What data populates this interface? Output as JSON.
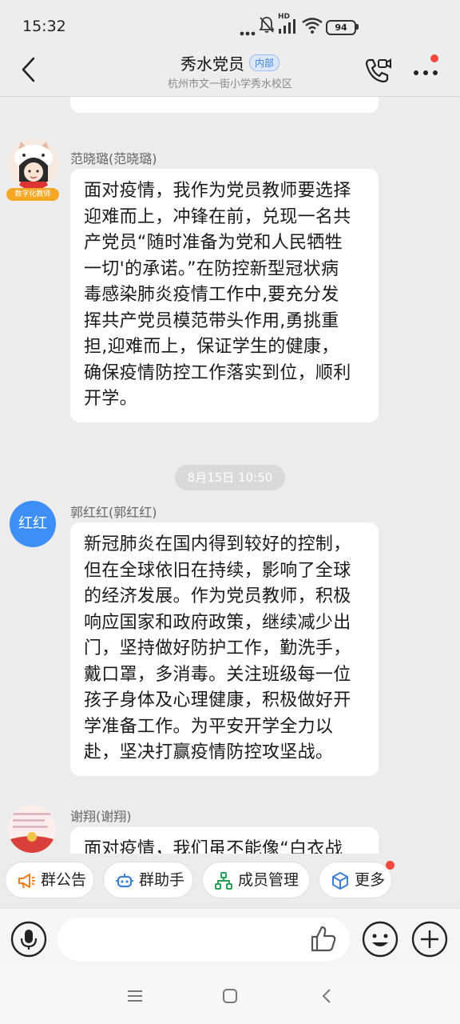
{
  "status": {
    "time": "15:32",
    "network": "HD",
    "battery": "94"
  },
  "header": {
    "title": "秀水党员",
    "badge": "内部",
    "subtitle": "杭州市文一街小学秀水校区"
  },
  "messages": [
    {
      "sender": "范晓璐(范晓璐)",
      "avatar_tag": "数字化教师",
      "text_lines": [
        "面对疫情，我作为党员教师要选择",
        "迎难而上，冲锋在前，兑现一名共",
        "产党员“随时准备为党和人民牺牲",
        "一切'的承诺。”在防控新型冠状病",
        "毒感染肺炎疫情工作中,要充分发",
        "挥共产党员模范带头作用,勇挑重",
        "担,迎难而上，保证学生的健康，",
        "确保疫情防控工作落实到位，顺利",
        "开学。"
      ]
    },
    {
      "timestamp": "8月15日 10:50",
      "sender": "郭红红(郭红红)",
      "avatar_text": "红红",
      "text_lines": [
        "新冠肺炎在国内得到较好的控制，",
        "但在全球依旧在持续，影响了全球",
        "的经济发展。作为党员教师，积极",
        "响应国家和政府政策，继续减少出",
        "门，坚持做好防护工作，勤洗手，",
        "戴口罩，多消毒。关注班级每一位",
        "孩子身体及心理健康，积极做好开",
        "学准备工作。为平安开学全力以",
        "赴，坚决打赢疫情防控攻坚战。"
      ]
    },
    {
      "sender": "谢翔(谢翔)",
      "text_lines": [
        "面对疫情，我们虽不能像“白衣战"
      ]
    }
  ],
  "quick_actions": [
    "群公告",
    "群助手",
    "成员管理",
    "更多"
  ],
  "input": {
    "placeholder": ""
  },
  "colors": {
    "accent": "#3f7fd6",
    "avatar_blue": "#3d8ff5",
    "notify_red": "#f04a3e"
  }
}
